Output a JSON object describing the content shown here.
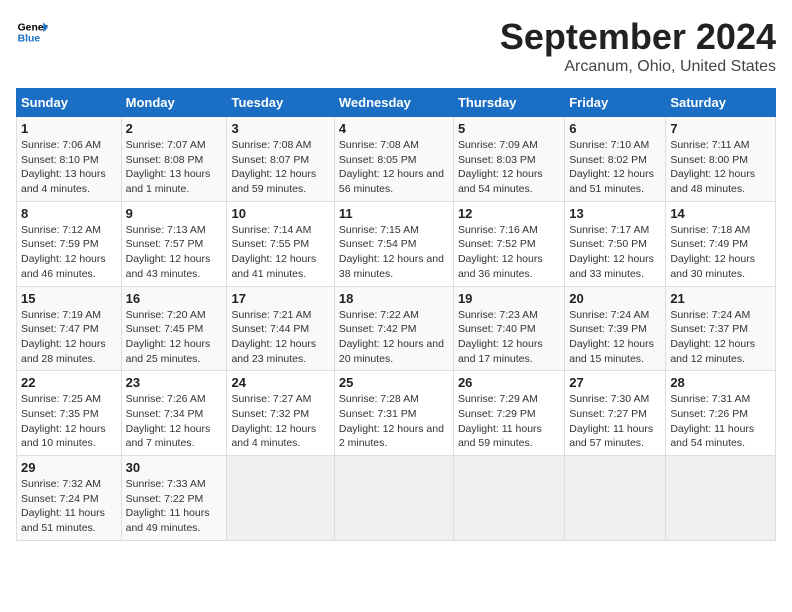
{
  "header": {
    "logo_line1": "General",
    "logo_line2": "Blue",
    "main_title": "September 2024",
    "subtitle": "Arcanum, Ohio, United States"
  },
  "weekdays": [
    "Sunday",
    "Monday",
    "Tuesday",
    "Wednesday",
    "Thursday",
    "Friday",
    "Saturday"
  ],
  "weeks": [
    [
      {
        "day": "1",
        "sunrise": "7:06 AM",
        "sunset": "8:10 PM",
        "daylight": "13 hours and 4 minutes."
      },
      {
        "day": "2",
        "sunrise": "7:07 AM",
        "sunset": "8:08 PM",
        "daylight": "13 hours and 1 minute."
      },
      {
        "day": "3",
        "sunrise": "7:08 AM",
        "sunset": "8:07 PM",
        "daylight": "12 hours and 59 minutes."
      },
      {
        "day": "4",
        "sunrise": "7:08 AM",
        "sunset": "8:05 PM",
        "daylight": "12 hours and 56 minutes."
      },
      {
        "day": "5",
        "sunrise": "7:09 AM",
        "sunset": "8:03 PM",
        "daylight": "12 hours and 54 minutes."
      },
      {
        "day": "6",
        "sunrise": "7:10 AM",
        "sunset": "8:02 PM",
        "daylight": "12 hours and 51 minutes."
      },
      {
        "day": "7",
        "sunrise": "7:11 AM",
        "sunset": "8:00 PM",
        "daylight": "12 hours and 48 minutes."
      }
    ],
    [
      {
        "day": "8",
        "sunrise": "7:12 AM",
        "sunset": "7:59 PM",
        "daylight": "12 hours and 46 minutes."
      },
      {
        "day": "9",
        "sunrise": "7:13 AM",
        "sunset": "7:57 PM",
        "daylight": "12 hours and 43 minutes."
      },
      {
        "day": "10",
        "sunrise": "7:14 AM",
        "sunset": "7:55 PM",
        "daylight": "12 hours and 41 minutes."
      },
      {
        "day": "11",
        "sunrise": "7:15 AM",
        "sunset": "7:54 PM",
        "daylight": "12 hours and 38 minutes."
      },
      {
        "day": "12",
        "sunrise": "7:16 AM",
        "sunset": "7:52 PM",
        "daylight": "12 hours and 36 minutes."
      },
      {
        "day": "13",
        "sunrise": "7:17 AM",
        "sunset": "7:50 PM",
        "daylight": "12 hours and 33 minutes."
      },
      {
        "day": "14",
        "sunrise": "7:18 AM",
        "sunset": "7:49 PM",
        "daylight": "12 hours and 30 minutes."
      }
    ],
    [
      {
        "day": "15",
        "sunrise": "7:19 AM",
        "sunset": "7:47 PM",
        "daylight": "12 hours and 28 minutes."
      },
      {
        "day": "16",
        "sunrise": "7:20 AM",
        "sunset": "7:45 PM",
        "daylight": "12 hours and 25 minutes."
      },
      {
        "day": "17",
        "sunrise": "7:21 AM",
        "sunset": "7:44 PM",
        "daylight": "12 hours and 23 minutes."
      },
      {
        "day": "18",
        "sunrise": "7:22 AM",
        "sunset": "7:42 PM",
        "daylight": "12 hours and 20 minutes."
      },
      {
        "day": "19",
        "sunrise": "7:23 AM",
        "sunset": "7:40 PM",
        "daylight": "12 hours and 17 minutes."
      },
      {
        "day": "20",
        "sunrise": "7:24 AM",
        "sunset": "7:39 PM",
        "daylight": "12 hours and 15 minutes."
      },
      {
        "day": "21",
        "sunrise": "7:24 AM",
        "sunset": "7:37 PM",
        "daylight": "12 hours and 12 minutes."
      }
    ],
    [
      {
        "day": "22",
        "sunrise": "7:25 AM",
        "sunset": "7:35 PM",
        "daylight": "12 hours and 10 minutes."
      },
      {
        "day": "23",
        "sunrise": "7:26 AM",
        "sunset": "7:34 PM",
        "daylight": "12 hours and 7 minutes."
      },
      {
        "day": "24",
        "sunrise": "7:27 AM",
        "sunset": "7:32 PM",
        "daylight": "12 hours and 4 minutes."
      },
      {
        "day": "25",
        "sunrise": "7:28 AM",
        "sunset": "7:31 PM",
        "daylight": "12 hours and 2 minutes."
      },
      {
        "day": "26",
        "sunrise": "7:29 AM",
        "sunset": "7:29 PM",
        "daylight": "11 hours and 59 minutes."
      },
      {
        "day": "27",
        "sunrise": "7:30 AM",
        "sunset": "7:27 PM",
        "daylight": "11 hours and 57 minutes."
      },
      {
        "day": "28",
        "sunrise": "7:31 AM",
        "sunset": "7:26 PM",
        "daylight": "11 hours and 54 minutes."
      }
    ],
    [
      {
        "day": "29",
        "sunrise": "7:32 AM",
        "sunset": "7:24 PM",
        "daylight": "11 hours and 51 minutes."
      },
      {
        "day": "30",
        "sunrise": "7:33 AM",
        "sunset": "7:22 PM",
        "daylight": "11 hours and 49 minutes."
      },
      null,
      null,
      null,
      null,
      null
    ]
  ]
}
